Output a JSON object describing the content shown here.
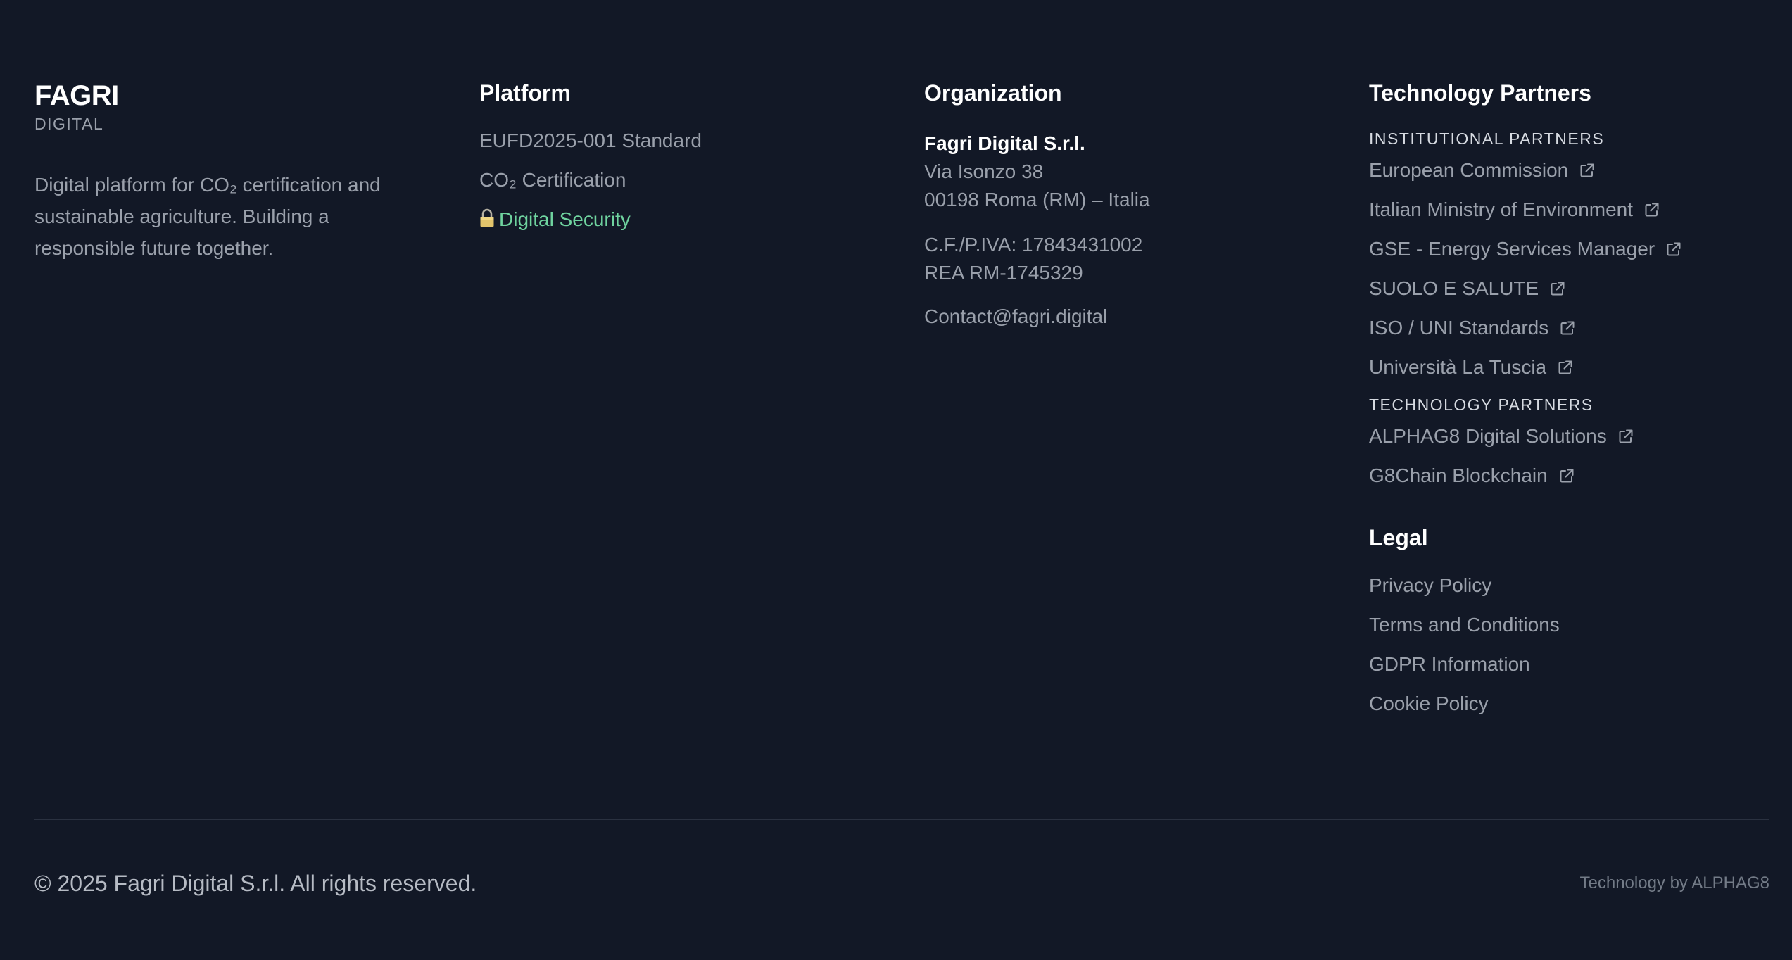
{
  "brand": {
    "name": "FAGRI",
    "subtitle": "DIGITAL",
    "description": "Digital platform for CO₂ certification and sustainable agriculture. Building a responsible future together."
  },
  "platform": {
    "title": "Platform",
    "links": [
      {
        "label": "EUFD2025-001 Standard"
      },
      {
        "label": "CO₂ Certification"
      },
      {
        "label": "Digital Security",
        "icon": "lock-icon",
        "color": "#6fd39f"
      }
    ]
  },
  "organization": {
    "title": "Organization",
    "name": "Fagri Digital S.r.l.",
    "address_line1": "Via Isonzo 38",
    "address_line2": "00198 Roma (RM) – Italia",
    "vat": "C.F./P.IVA: 17843431002",
    "rea": "REA RM-1745329",
    "contact": "Contact@fagri.digital"
  },
  "partners": {
    "title": "Technology Partners",
    "institutional_label": "INSTITUTIONAL PARTNERS",
    "institutional": [
      {
        "label": "European Commission",
        "icon": "external-link-icon"
      },
      {
        "label": "Italian Ministry of Environment",
        "icon": "external-link-icon"
      },
      {
        "label": "GSE - Energy Services Manager",
        "icon": "external-link-icon"
      },
      {
        "label": "SUOLO E SALUTE",
        "icon": "external-link-icon"
      },
      {
        "label": "ISO / UNI Standards",
        "icon": "external-link-icon"
      },
      {
        "label": "Università La Tuscia",
        "icon": "external-link-icon"
      }
    ],
    "technology_label": "TECHNOLOGY PARTNERS",
    "technology": [
      {
        "label": "ALPHAG8 Digital Solutions",
        "icon": "external-link-icon"
      },
      {
        "label": "G8Chain Blockchain",
        "icon": "external-link-icon"
      }
    ]
  },
  "legal": {
    "title": "Legal",
    "links": [
      {
        "label": "Privacy Policy"
      },
      {
        "label": "Terms and Conditions"
      },
      {
        "label": "GDPR Information"
      },
      {
        "label": "Cookie Policy"
      }
    ]
  },
  "bottom": {
    "copyright": "© 2025 Fagri Digital S.r.l. All rights reserved.",
    "technology_by": "Technology by ALPHAG8"
  },
  "colors": {
    "background": "#121826",
    "text_muted": "#9aa0ab",
    "heading": "#ffffff",
    "accent_green": "#6fd39f"
  }
}
